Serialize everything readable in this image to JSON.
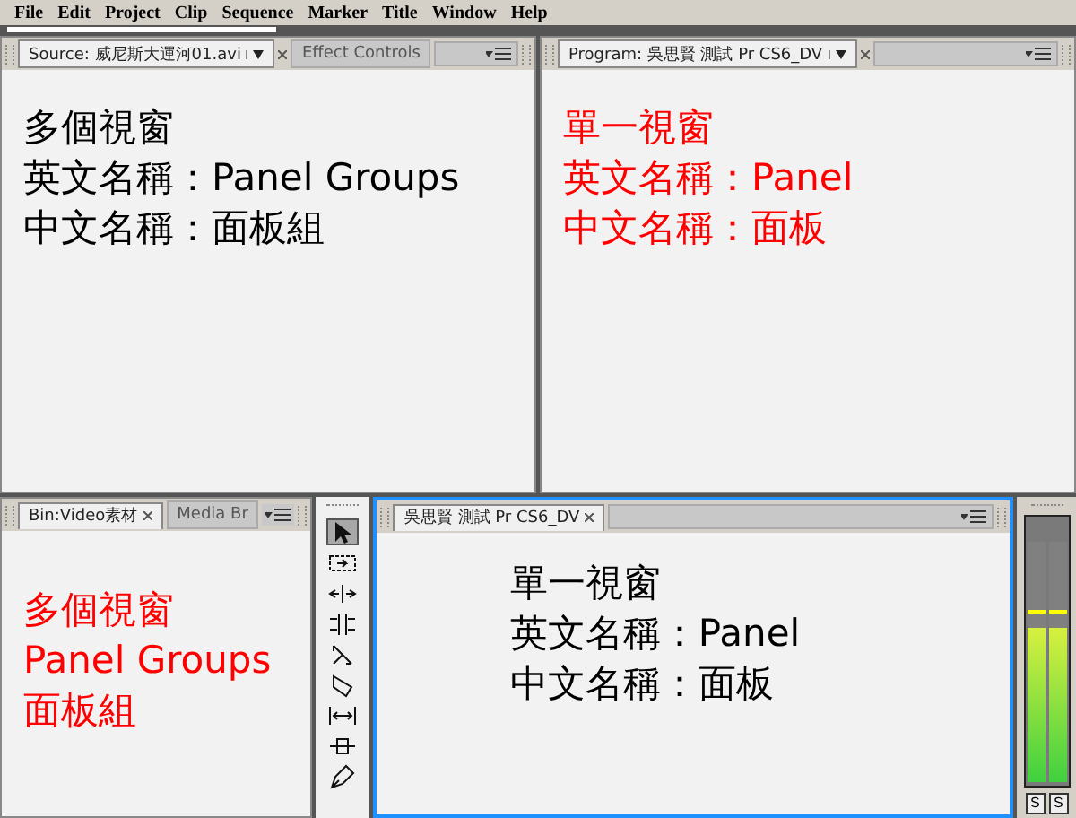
{
  "menu": [
    "File",
    "Edit",
    "Project",
    "Clip",
    "Sequence",
    "Marker",
    "Title",
    "Window",
    "Help"
  ],
  "top_left": {
    "tabs": [
      {
        "label": "Source: 威尼斯大運河01.avi",
        "selected": true,
        "dropdown": true
      },
      {
        "label": "Effect Controls",
        "selected": false
      }
    ],
    "note": {
      "color": "#000000",
      "lines": [
        "多個視窗",
        "英文名稱：Panel Groups",
        "中文名稱：面板組"
      ]
    }
  },
  "top_right": {
    "tabs": [
      {
        "label": "Program: 吳思賢 測試 Pr CS6_DV",
        "selected": true,
        "dropdown": true
      }
    ],
    "note": {
      "color": "#ff0000",
      "lines": [
        "單一視窗",
        "英文名稱：Panel",
        "中文名稱：面板"
      ]
    }
  },
  "bottom_left": {
    "tabs": [
      {
        "label": "Bin:Video素材",
        "selected": true
      },
      {
        "label": "Media Br",
        "selected": false
      }
    ],
    "note": {
      "color": "#ff0000",
      "lines": [
        "多個視窗",
        "Panel Groups",
        "面板組"
      ]
    }
  },
  "tools": [
    {
      "kind": "select",
      "selected": true
    },
    {
      "kind": "track",
      "selected": false
    },
    {
      "kind": "ripple",
      "selected": false
    },
    {
      "kind": "rolling",
      "selected": false
    },
    {
      "kind": "rate",
      "selected": false
    },
    {
      "kind": "razor",
      "selected": false
    },
    {
      "kind": "slip",
      "selected": false
    },
    {
      "kind": "slide",
      "selected": false
    },
    {
      "kind": "pen",
      "selected": false
    }
  ],
  "timeline": {
    "active": true,
    "tabs": [
      {
        "label": "吳思賢 測試 Pr CS6_DV",
        "selected": true
      }
    ],
    "note": {
      "color": "#000000",
      "lines": [
        "單一視窗",
        "英文名稱：Panel",
        "中文名稱：面板"
      ]
    }
  },
  "audio_meter": {
    "channels": [
      {
        "level": 0.64,
        "solo": "S"
      },
      {
        "level": 0.64,
        "solo": "S"
      }
    ]
  }
}
